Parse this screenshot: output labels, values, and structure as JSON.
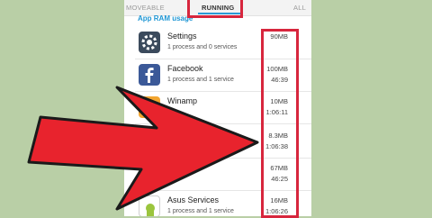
{
  "tabs": {
    "moveable": "MOVEABLE",
    "running": "RUNNING",
    "all": "ALL"
  },
  "section_header": "App RAM usage",
  "apps": [
    {
      "name": "Settings",
      "detail": "1 process and 0 services",
      "memory": "90MB",
      "time": "",
      "icon": "gear-icon"
    },
    {
      "name": "Facebook",
      "detail": "1 process and 1 service",
      "memory": "100MB",
      "time": "46:39",
      "icon": "facebook-icon"
    },
    {
      "name": "Winamp",
      "detail": "",
      "memory": "10MB",
      "time": "1:06:11",
      "icon": "winamp-icon"
    },
    {
      "name": "",
      "detail": "",
      "memory": "8.3MB",
      "time": "1:06:38",
      "icon": ""
    },
    {
      "name": "",
      "detail": "",
      "memory": "67MB",
      "time": "46:25",
      "icon": ""
    },
    {
      "name": "Asus Services",
      "detail": "1 process and 1 service",
      "memory": "16MB",
      "time": "1:06:26",
      "icon": "asus-icon"
    }
  ],
  "colors": {
    "highlight": "#d7263d",
    "arrow": "#e8232d",
    "accent": "#1e96d4",
    "background": "#b9cfa6"
  }
}
